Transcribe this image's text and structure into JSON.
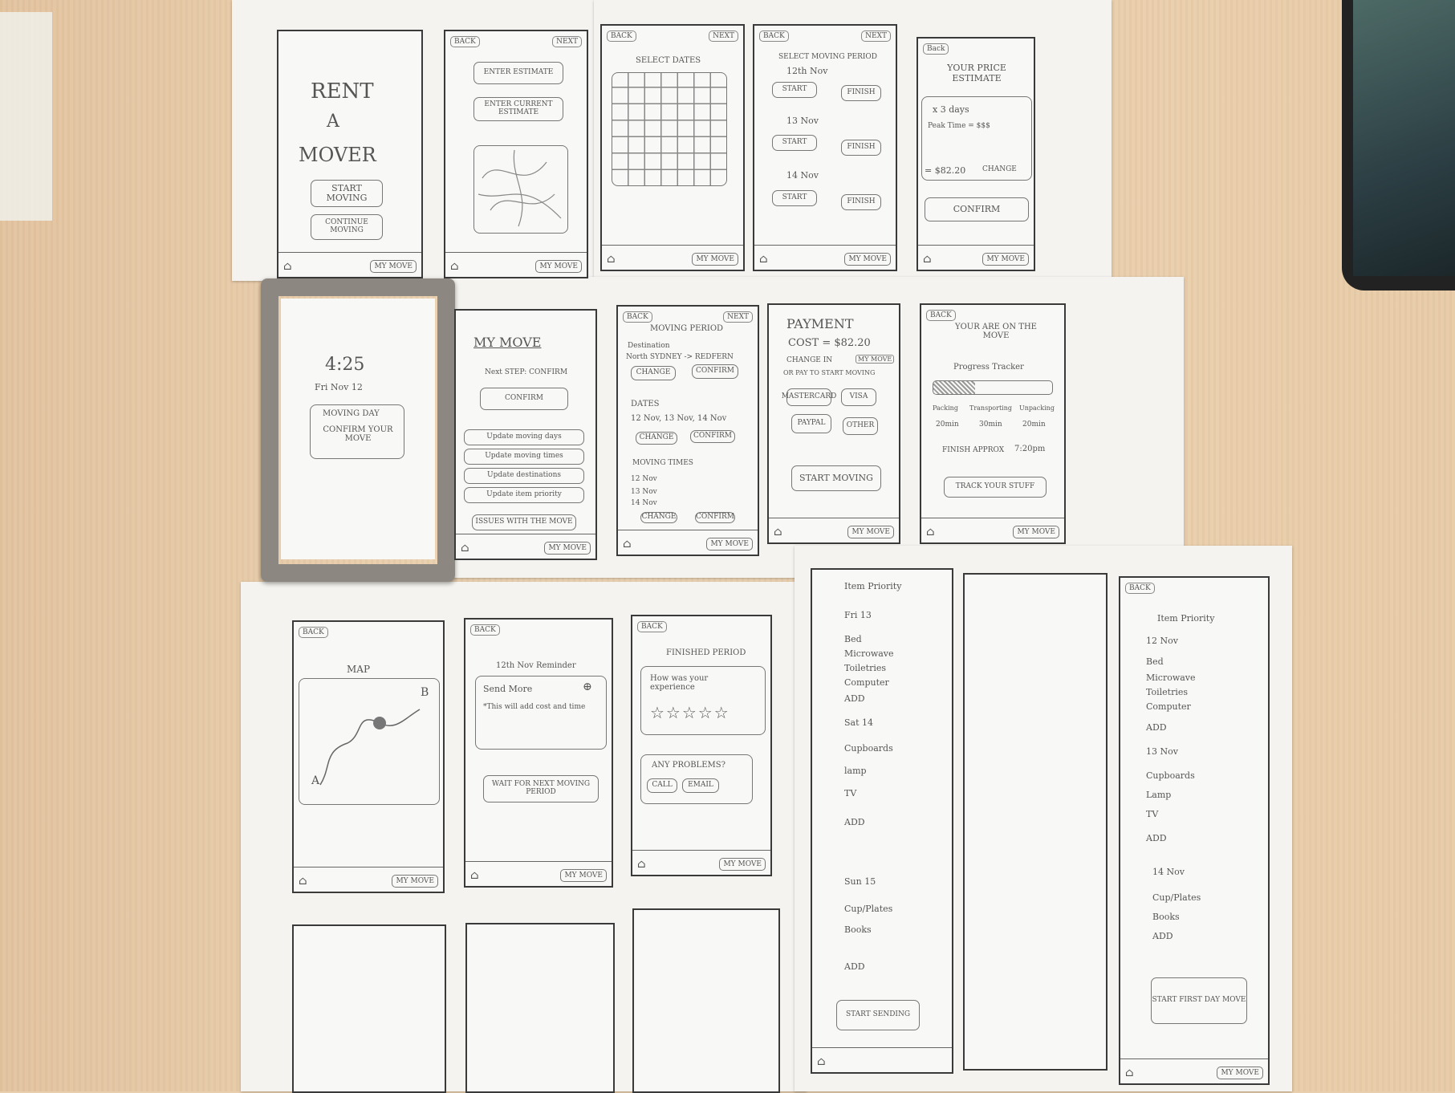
{
  "scene": {
    "colors": {
      "desk": "#e9cfae",
      "paper": "#f4f3ef",
      "pencil": "#555555",
      "cardboard": "#8c8780"
    }
  },
  "common": {
    "back": "BACK",
    "next": "NEXT",
    "mymove": "MY MOVE",
    "home_icon": "house-icon"
  },
  "s1": {
    "title1": "RENT",
    "title2": "A",
    "title3": "MOVER",
    "start": "START MOVING",
    "continue": "CONTINUE MOVING"
  },
  "s2": {
    "enter_estimate": "ENTER ESTIMATE",
    "enter_current": "ENTER CURRENT ESTIMATE"
  },
  "s3": {
    "title": "SELECT DATES"
  },
  "s4": {
    "title": "SELECT MOVING PERIOD",
    "day1": "12th Nov",
    "day2": "13 Nov",
    "day3": "14 Nov",
    "start": "START",
    "finish": "FINISH"
  },
  "s5": {
    "back": "Back",
    "title": "YOUR PRICE ESTIMATE",
    "days": "x 3 days",
    "peak": "Peak Time = $$$",
    "price": "= $82.20",
    "change": "CHANGE",
    "confirm": "CONFIRM"
  },
  "s6": {
    "time": "4:25",
    "date": "Fri Nov 12",
    "moving_day": "MOVING DAY",
    "confirm": "CONFIRM YOUR MOVE"
  },
  "s7": {
    "title": "MY MOVE",
    "next_step": "Next STEP: CONFIRM",
    "confirm": "CONFIRM",
    "items": [
      "Update moving days",
      "Update moving times",
      "Update destinations",
      "Update item priority"
    ],
    "issues": "ISSUES WITH THE MOVE"
  },
  "s8": {
    "title": "MOVING PERIOD",
    "destination": "Destination",
    "route": "North SYDNEY -> REDFERN",
    "change": "CHANGE",
    "confirm": "CONFIRM",
    "dates": "DATES",
    "dates_val": "12 Nov, 13 Nov, 14 Nov",
    "times": "MOVING TIMES",
    "t1": "12 Nov",
    "t2": "13 Nov",
    "t3": "14 Nov"
  },
  "s9": {
    "title": "PAYMENT",
    "cost": "COST = $82.20",
    "change_in": "CHANGE IN",
    "mymove": "MY MOVE",
    "or_pay": "OR PAY TO START MOVING",
    "mastercard": "MASTERCARD",
    "visa": "VISA",
    "paypal": "PAYPAL",
    "other": "OTHER",
    "start": "START MOVING"
  },
  "s10": {
    "title": "YOUR ARE ON THE MOVE",
    "tracker": "Progress Tracker",
    "packing": "Packing",
    "transporting": "Transporting",
    "unpacking": "Unpacking",
    "p_time": "20min",
    "t_time": "30min",
    "u_time": "20min",
    "finish": "FINISH APPROX",
    "finish_time": "7:20pm",
    "track": "TRACK YOUR STUFF",
    "progress": 0.35
  },
  "s11": {
    "title": "MAP",
    "a": "A",
    "b": "B"
  },
  "s12": {
    "title": "12th Nov Reminder",
    "send_more": "Send More",
    "note": "*This will add cost and time",
    "wait": "WAIT FOR NEXT MOVING PERIOD"
  },
  "s13": {
    "title": "FINISHED PERIOD",
    "experience": "How was your experience",
    "stars": "☆☆☆☆☆",
    "problems": "ANY PROBLEMS?",
    "call": "CALL",
    "email": "EMAIL"
  },
  "s14": {
    "title": "Item Priority",
    "d1": "Fri 13",
    "d1_items": [
      "Bed",
      "Microwave",
      "Toiletries",
      "Computer"
    ],
    "d2": "Sat 14",
    "d2_items": [
      "Cupboards",
      "lamp",
      "TV"
    ],
    "d3": "Sun 15",
    "d3_items": [
      "Cup/Plates",
      "Books"
    ],
    "add": "ADD",
    "start": "START SENDING"
  },
  "s15": {
    "title": "Item Priority",
    "d1": "12 Nov",
    "d1_items": [
      "Bed",
      "Microwave",
      "Toiletries",
      "Computer"
    ],
    "d2": "13 Nov",
    "d2_items": [
      "Cupboards",
      "Lamp",
      "TV"
    ],
    "d3": "14 Nov",
    "d3_items": [
      "Cup/Plates",
      "Books"
    ],
    "add": "ADD",
    "start": "START FIRST DAY MOVE"
  }
}
